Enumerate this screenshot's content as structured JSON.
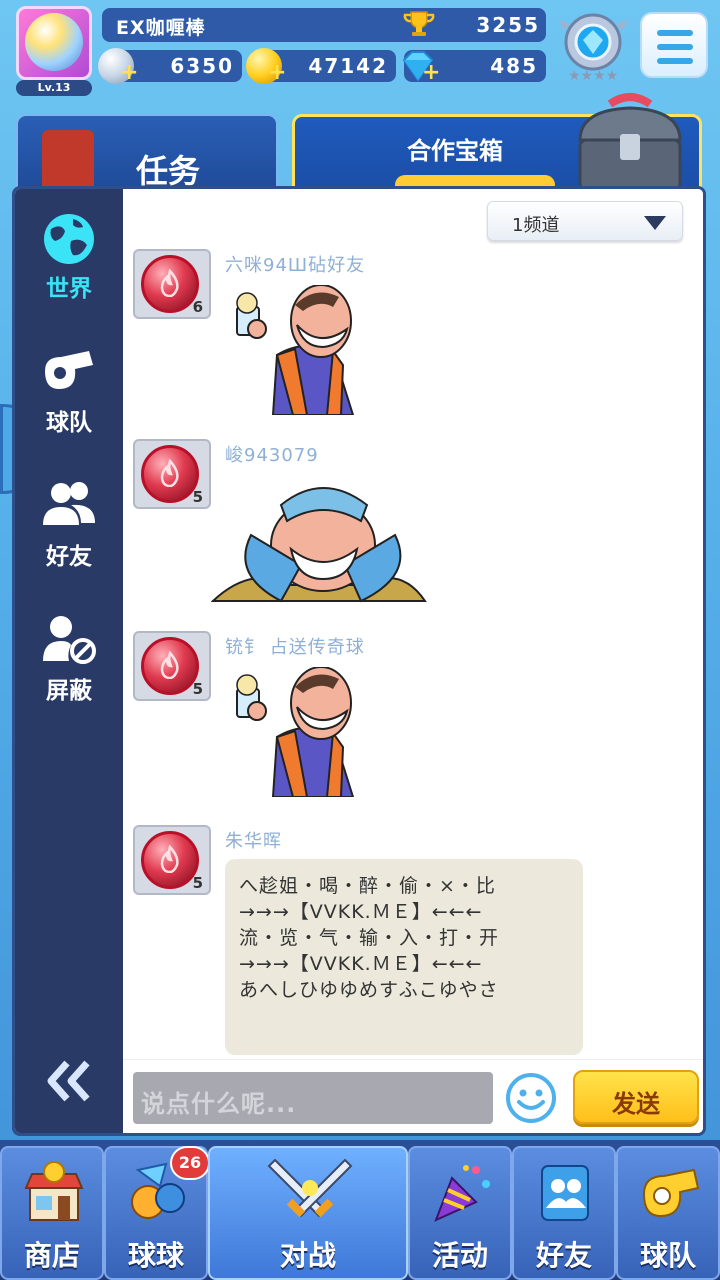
{
  "player": {
    "name": "EX咖喱棒",
    "level": "Lv.13",
    "trophies": "3255"
  },
  "currency": {
    "silver": "6350",
    "gold": "47142",
    "diamond": "485"
  },
  "cards": {
    "task_label": "任务",
    "chest_label": "合作宝箱"
  },
  "sidebar": {
    "items": [
      {
        "label": "世界",
        "icon": "globe-icon"
      },
      {
        "label": "球队",
        "icon": "whistle-icon"
      },
      {
        "label": "好友",
        "icon": "friends-icon"
      },
      {
        "label": "屏蔽",
        "icon": "block-user-icon"
      }
    ],
    "active": "世界"
  },
  "channel": {
    "selected": "1频道"
  },
  "messages": [
    {
      "user": "六咪94Ш砧好友",
      "level": "6",
      "type": "sticker",
      "sticker": "beer-cheer"
    },
    {
      "user": "峻943079",
      "level": "5",
      "type": "sticker",
      "sticker": "crying"
    },
    {
      "user": "铳钅 占送传奇球",
      "level": "5",
      "type": "sticker",
      "sticker": "beer-cheer"
    },
    {
      "user": "朱华晖",
      "level": "5",
      "type": "text",
      "lines": [
        "へ趁姐・喝・醉・偷・×・比",
        "→→→【VVKK.ＭＥ】←←←",
        "流・览・气・输・入・打・开",
        "→→→【VVKK.ＭＥ】←←←",
        "あへしひゆゆめすふこゆやさ"
      ]
    }
  ],
  "composer": {
    "placeholder": "说点什么呢...",
    "send_label": "发送"
  },
  "nav": {
    "items": [
      {
        "label": "商店",
        "icon": "shop-icon"
      },
      {
        "label": "球球",
        "icon": "balls-icon",
        "badge": "26"
      },
      {
        "label": "对战",
        "icon": "crossed-swords-icon"
      },
      {
        "label": "活动",
        "icon": "party-popper-icon"
      },
      {
        "label": "好友",
        "icon": "friends-book-icon"
      },
      {
        "label": "球队",
        "icon": "team-whistle-icon"
      }
    ],
    "active": "对战"
  },
  "colors": {
    "accent": "#3be3f6",
    "sidebar": "#293a67",
    "send": "#ffd02a",
    "badge": "#e23b3b"
  }
}
